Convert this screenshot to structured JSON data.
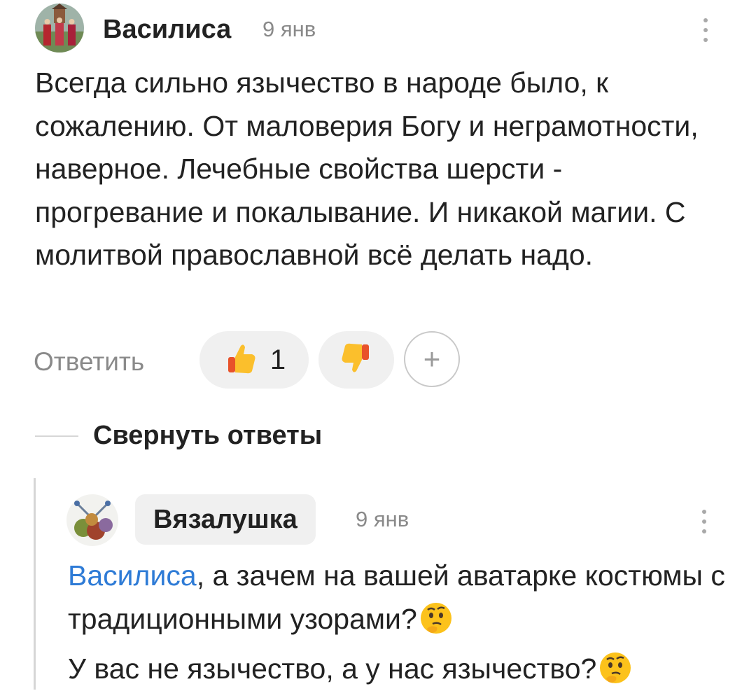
{
  "comment": {
    "author": "Василиса",
    "date": "9 янв",
    "text": "Всегда сильно язычество в народе было, к сожалению. От маловерия Богу и неграмотности, наверное. Лечебные свойства шерсти - прогревание и покалывание. И никакой магии. С молитвой православной всё делать надо.",
    "reply_label": "Ответить",
    "like_count": "1",
    "plus_label": "+"
  },
  "replies": {
    "collapse_label": "Свернуть ответы",
    "reply": {
      "author": "Вязалушка",
      "date": "9 янв",
      "mention": "Василиса",
      "text_line1": ", а зачем на вашей аватарке костюмы с традиционными узорами?",
      "text_line2": "У вас не язычество, а у нас язычество?"
    }
  },
  "icons": {
    "like": "thumbs-up-icon",
    "dislike": "thumbs-down-icon",
    "menu": "more-vertical-icon",
    "emoji": "thinking-face-emoji"
  }
}
